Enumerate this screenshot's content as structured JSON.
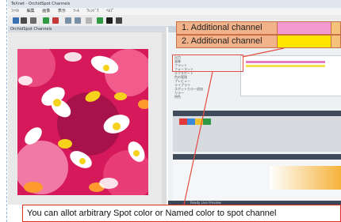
{
  "window": {
    "title": "TeXnet - OrchidSpot Channels"
  },
  "menu": [
    "ﾌｧｲﾙ",
    "編集",
    "画像",
    "表示",
    "ﾂｰﾙ",
    "ｳｨﾝﾄﾞｳ",
    "ﾍﾙﾌﾟ"
  ],
  "document_tab": "OrchidSpot Channels",
  "channels": [
    {
      "label": "1. Additional channel",
      "color": "#f29ad0",
      "extra": "#f4c27a"
    },
    {
      "label": "2. Additional channel",
      "color": "#ffe600",
      "extra": "#f4c27a"
    }
  ],
  "tree_items": [
    "出力",
    "画像",
    "フラット",
    "フォーマット",
    "エクスポート",
    "色の管理",
    "プレビュー",
    "ライブラリ",
    "スポットカラー追加",
    "カラー",
    "特色"
  ],
  "colors": {
    "accent_red": "#d9321f",
    "channel_label_bg": "#f2b38a"
  },
  "statusbar": "Ready  Live Preview",
  "caption": "You can allot arbitrary Spot color or Named color to spot channel"
}
